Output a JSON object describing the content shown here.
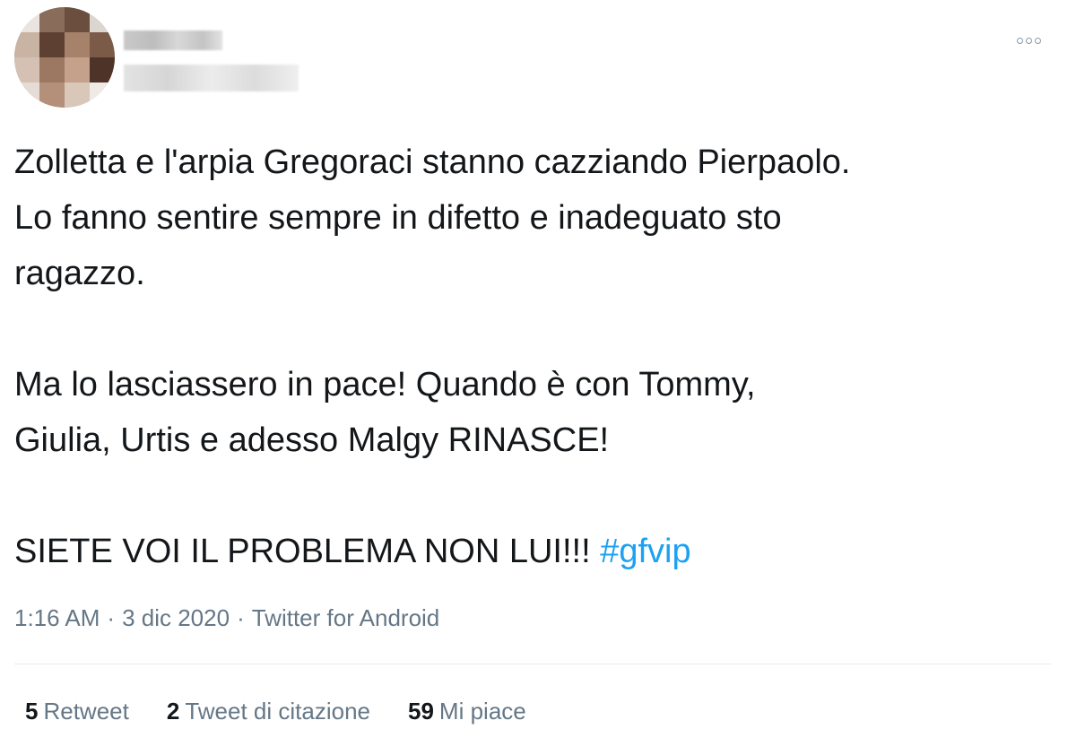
{
  "tweet": {
    "text_lines": [
      "Zolletta e l'arpia Gregoraci stanno cazziando Pierpaolo.",
      "Lo fanno sentire sempre in difetto e inadeguato sto",
      "ragazzo.",
      "Ma lo lasciassero in pace! Quando è con Tommy,",
      "Giulia, Urtis e adesso Malgy RINASCE!",
      "SIETE VOI IL PROBLEMA NON LUI!!! "
    ],
    "hashtag": "#gfvip",
    "time": "1:16 AM",
    "date": "3 dic 2020",
    "source": "Twitter for Android",
    "separator": "·"
  },
  "stats": {
    "retweets": {
      "count": "5",
      "label": "Retweet"
    },
    "quotes": {
      "count": "2",
      "label": "Tweet di citazione"
    },
    "likes": {
      "count": "59",
      "label": "Mi piace"
    }
  },
  "colors": {
    "text": "#14171a",
    "muted": "#657786",
    "link": "#1da1f2",
    "divider": "#e6ecf0"
  },
  "icons": {
    "more": "more-options-icon"
  }
}
